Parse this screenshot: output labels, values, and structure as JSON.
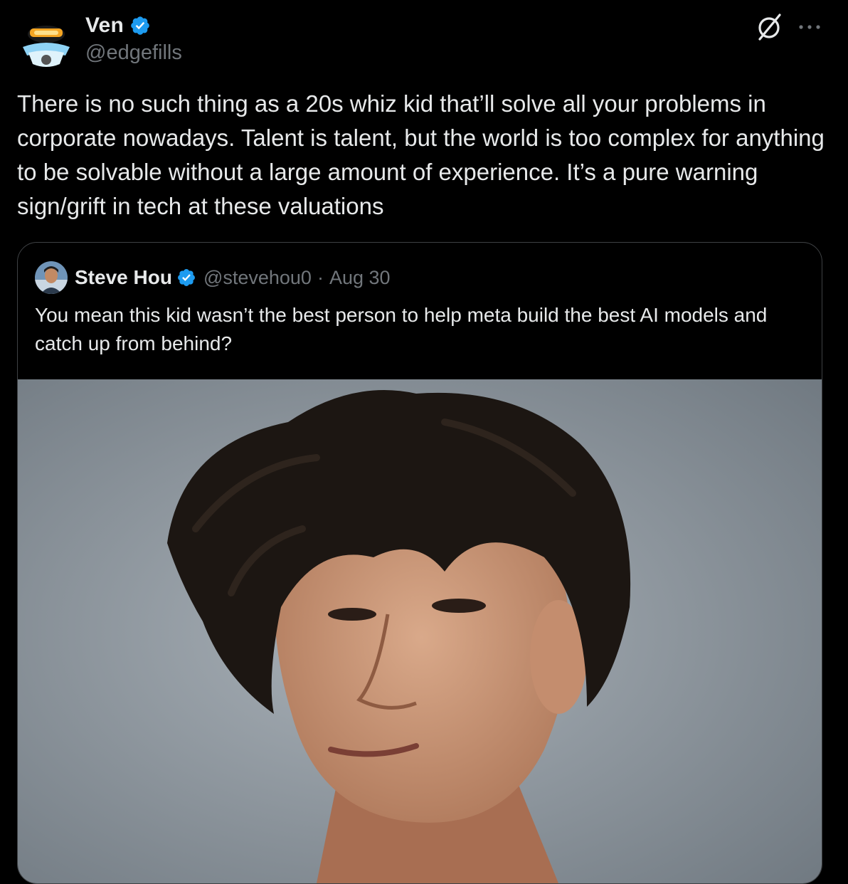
{
  "author": {
    "display_name": "Ven",
    "handle": "@edgefills",
    "verified": true
  },
  "tweet": {
    "text": "There is no such thing as a 20s whiz kid that’ll solve all your problems in corporate nowadays. Talent is talent, but the world is too complex for anything to be solvable without a large amount of experience. It’s a pure warning sign/grift in tech at these valuations"
  },
  "quoted": {
    "display_name": "Steve Hou",
    "handle": "@stevehou0",
    "separator": "·",
    "date": "Aug 30",
    "text": "You mean this kid wasn’t the best person to help meta build the best AI models and catch up from behind?"
  },
  "icons": {
    "grok": "grok-icon",
    "more": "more-icon",
    "verified": "verified-badge-icon"
  },
  "colors": {
    "background": "#000000",
    "text_primary": "#e7e9ea",
    "text_secondary": "#71767b",
    "verified_blue": "#1d9bf0",
    "card_border": "#3e4144"
  }
}
